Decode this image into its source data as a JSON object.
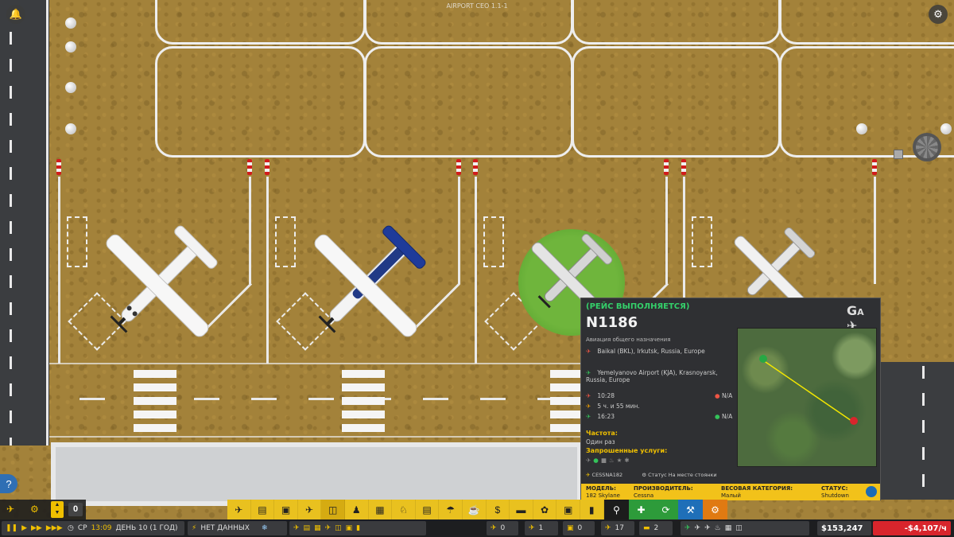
{
  "game": {
    "version": "AIRPORT CEO 1.1-1"
  },
  "top_buttons": {
    "notifications_icon": "bell-icon",
    "settings_icon": "gear-icon",
    "help_label": "?"
  },
  "flight_panel": {
    "status": "(РЕЙС ВЫПОЛНЯЕТСЯ)",
    "flight_number": "N1186",
    "category": "Авиация общего назначения",
    "origin": "Baikal (BKL), Irkutsk, Russia, Europe",
    "destination": "Yemelyanovo Airport (KJA), Krasnoyarsk, Russia, Europe",
    "departure_time": "10:28",
    "duration": "5 ч. и 55 мин.",
    "arrival_time": "16:23",
    "departure_delay": "N/A",
    "arrival_delay": "N/A",
    "frequency_label": "Частота:",
    "frequency_value": "Один раз",
    "services_label": "Запрошенные услуги:",
    "aircraft_tag": "CESSNA182",
    "stand_status": "Статус На месте стоянки",
    "specs": {
      "model_label": "МОДЕЛЬ:",
      "model_value": "182 Skylane",
      "maker_label": "ПРОИЗВОДИТЕЛЬ:",
      "maker_value": "Cessna",
      "weight_label": "ВЕСОВАЯ КАТЕГОРИЯ:",
      "weight_value": "Малый",
      "status_label": "СТАТУС:",
      "status_value": "Shutdown"
    }
  },
  "left_controls": {
    "counter": "0"
  },
  "status_bar": {
    "weekday": "СР",
    "time": "13:09",
    "day": "ДЕНЬ 10 (1 ГОД)",
    "weather": "НЕТ ДАННЫХ",
    "counts": [
      "0",
      "1",
      "0",
      "17",
      "2"
    ],
    "money": "$153,247",
    "delta": "-$4,107/ч"
  },
  "colors": {
    "toolbar": "#e9c11f",
    "accent_green": "#34d06a",
    "warning_red": "#d8252c"
  }
}
